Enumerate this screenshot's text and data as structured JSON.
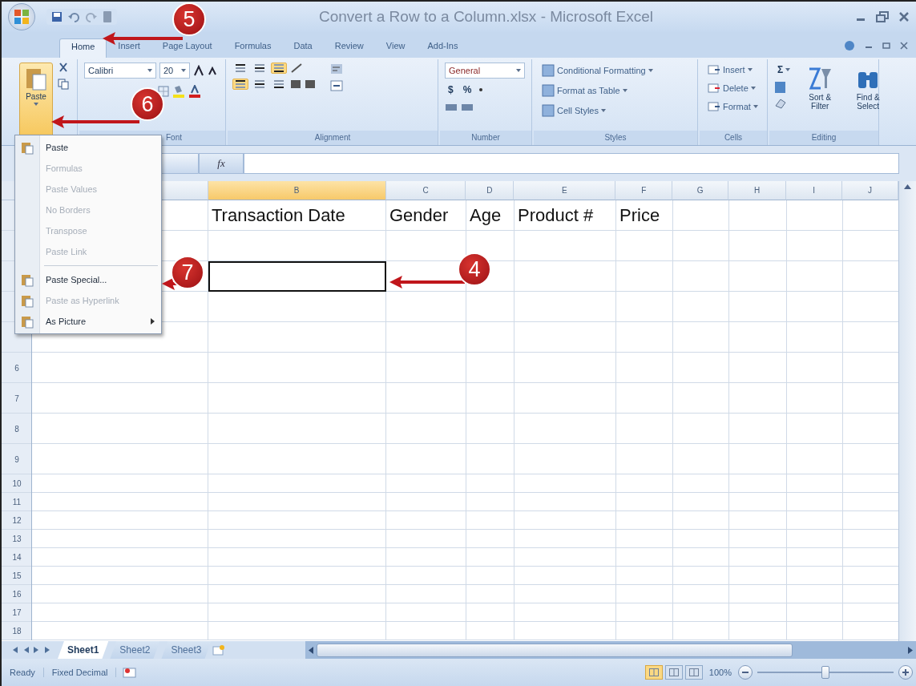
{
  "window": {
    "title": "Convert a Row to a Column.xlsx - Microsoft Excel"
  },
  "tabs": [
    {
      "label": "Home",
      "selected": true
    },
    {
      "label": "Insert",
      "selected": false
    },
    {
      "label": "Page Layout",
      "selected": false
    },
    {
      "label": "Formulas",
      "selected": false
    },
    {
      "label": "Data",
      "selected": false
    },
    {
      "label": "Review",
      "selected": false
    },
    {
      "label": "View",
      "selected": false
    },
    {
      "label": "Add-Ins",
      "selected": false
    }
  ],
  "clipboard": {
    "paste_label": "Paste"
  },
  "font": {
    "label": "Font",
    "font_name": "Calibri",
    "font_size": "20"
  },
  "alignment": {
    "label": "Alignment",
    "vertical": [
      {
        "selected": false
      },
      {
        "selected": false
      },
      {
        "selected": true
      }
    ],
    "horizontal": [
      {
        "selected": true
      },
      {
        "selected": false
      },
      {
        "selected": false
      }
    ]
  },
  "number": {
    "label": "Number",
    "format": "General",
    "symbols": [
      "$",
      "%"
    ]
  },
  "styles": {
    "label": "Styles",
    "buttons": [
      "Conditional Formatting",
      "Format as Table",
      "Cell Styles"
    ]
  },
  "cells": {
    "label": "Cells",
    "buttons": [
      "Insert",
      "Delete",
      "Format"
    ]
  },
  "editing": {
    "label": "Editing",
    "sum_symbol": "Σ",
    "buttons": [
      "Sort & Filter",
      "Find & Select"
    ]
  },
  "formula_bar": {
    "function_label": "fx"
  },
  "sheet": {
    "columns": [
      {
        "selected": false
      },
      {
        "label": "B",
        "selected": true
      },
      {
        "label": "C",
        "selected": false
      },
      {
        "label": "D",
        "selected": false
      },
      {
        "label": "E",
        "selected": false
      },
      {
        "label": "F",
        "selected": false
      },
      {
        "label": "G",
        "selected": false
      },
      {
        "label": "H",
        "selected": false
      },
      {
        "label": "I",
        "selected": false
      },
      {
        "label": "J",
        "selected": false
      }
    ],
    "rows": [
      {
        "selected": false,
        "cells": [
          "Transaction Date",
          "Gender",
          "Age",
          "Product #",
          "Price"
        ]
      },
      {
        "selected": false
      },
      {
        "selected": true
      },
      {
        "selected": false
      },
      {
        "selected": false
      },
      {
        "header": "6",
        "selected": false
      },
      {
        "header": "7",
        "selected": false
      },
      {
        "header": "8",
        "selected": false
      },
      {
        "header": "9",
        "selected": false
      },
      {
        "header": "10",
        "selected": false
      },
      {
        "header": "11",
        "selected": false
      },
      {
        "header": "12",
        "selected": false
      },
      {
        "header": "13",
        "selected": false
      },
      {
        "header": "14",
        "selected": false
      },
      {
        "header": "15",
        "selected": false
      },
      {
        "header": "16",
        "selected": false
      },
      {
        "header": "17",
        "selected": false
      },
      {
        "header": "18",
        "selected": false
      }
    ]
  },
  "paste_menu": {
    "items": [
      {
        "label": "Paste",
        "disabled": false,
        "icon": true,
        "submenu": false
      },
      {
        "label": "Formulas",
        "disabled": true,
        "icon": false,
        "submenu": false
      },
      {
        "label": "Paste Values",
        "disabled": true,
        "icon": false,
        "submenu": false
      },
      {
        "label": "No Borders",
        "disabled": true,
        "icon": false,
        "submenu": false
      },
      {
        "label": "Transpose",
        "disabled": true,
        "icon": false,
        "submenu": false
      },
      {
        "label": "Paste Link",
        "disabled": true,
        "icon": false,
        "submenu": false
      },
      {
        "label": "Paste Special...",
        "disabled": false,
        "icon": true,
        "submenu": false
      },
      {
        "label": "Paste as Hyperlink",
        "disabled": true,
        "icon": true,
        "submenu": false
      },
      {
        "label": "As Picture",
        "disabled": false,
        "icon": true,
        "submenu": true
      }
    ]
  },
  "sheet_tabs": [
    {
      "label": "Sheet1",
      "selected": true
    },
    {
      "label": "Sheet2",
      "selected": false
    },
    {
      "label": "Sheet3",
      "selected": false
    }
  ],
  "status_bar": {
    "items": [
      "Ready",
      "Fixed Decimal"
    ],
    "views": [
      {
        "selected": true
      },
      {
        "selected": false
      },
      {
        "selected": false
      }
    ],
    "zoom": "100%",
    "zoom_slider": {
      "level": 0.5
    }
  },
  "callouts": [
    {
      "number": "5"
    },
    {
      "number": "6"
    },
    {
      "number": "7"
    },
    {
      "number": "4"
    }
  ]
}
